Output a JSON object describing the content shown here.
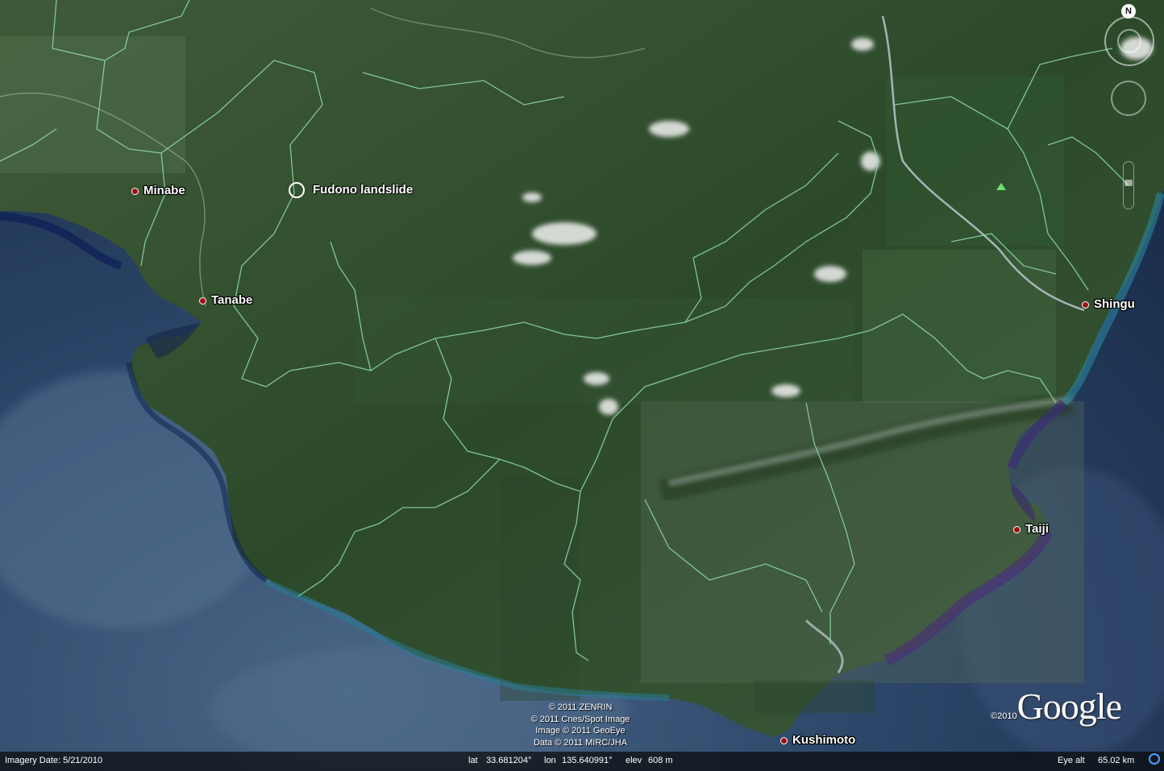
{
  "map": {
    "places": [
      {
        "label": "Minabe"
      },
      {
        "label": "Tanabe"
      },
      {
        "label": "Shingu"
      },
      {
        "label": "Taiji"
      },
      {
        "label": "Kushimoto"
      }
    ],
    "poi": {
      "label": "Fudono landslide",
      "icon": "circle-marker-icon"
    },
    "peak_icon": "green-triangle-icon",
    "colors": {
      "land": "#2f4f2c",
      "sea": "#1f3551",
      "coast_dark": "#0b1a44",
      "boundary": "#8fd9b0",
      "town_dot": "#9e1010"
    }
  },
  "credits": [
    "© 2011 ZENRIN",
    "© 2011 Cnes/Spot Image",
    "Image © 2011 GeoEye",
    "Data © 2011 MIRC/JHA"
  ],
  "logo": {
    "year": "©2010",
    "name": "Google"
  },
  "status": {
    "imagery_date": "Imagery Date: 5/21/2010",
    "lat_label": "lat",
    "lat": "33.681204°",
    "lon_label": "lon",
    "lon": "135.640991°",
    "elev_label": "elev",
    "elev": "608 m",
    "eye_label": "Eye alt",
    "eye": "65.02 km"
  },
  "nav": {
    "north": "N",
    "icons": [
      "compass-ring-icon",
      "look-joystick-icon",
      "zoom-slider-icon"
    ]
  }
}
